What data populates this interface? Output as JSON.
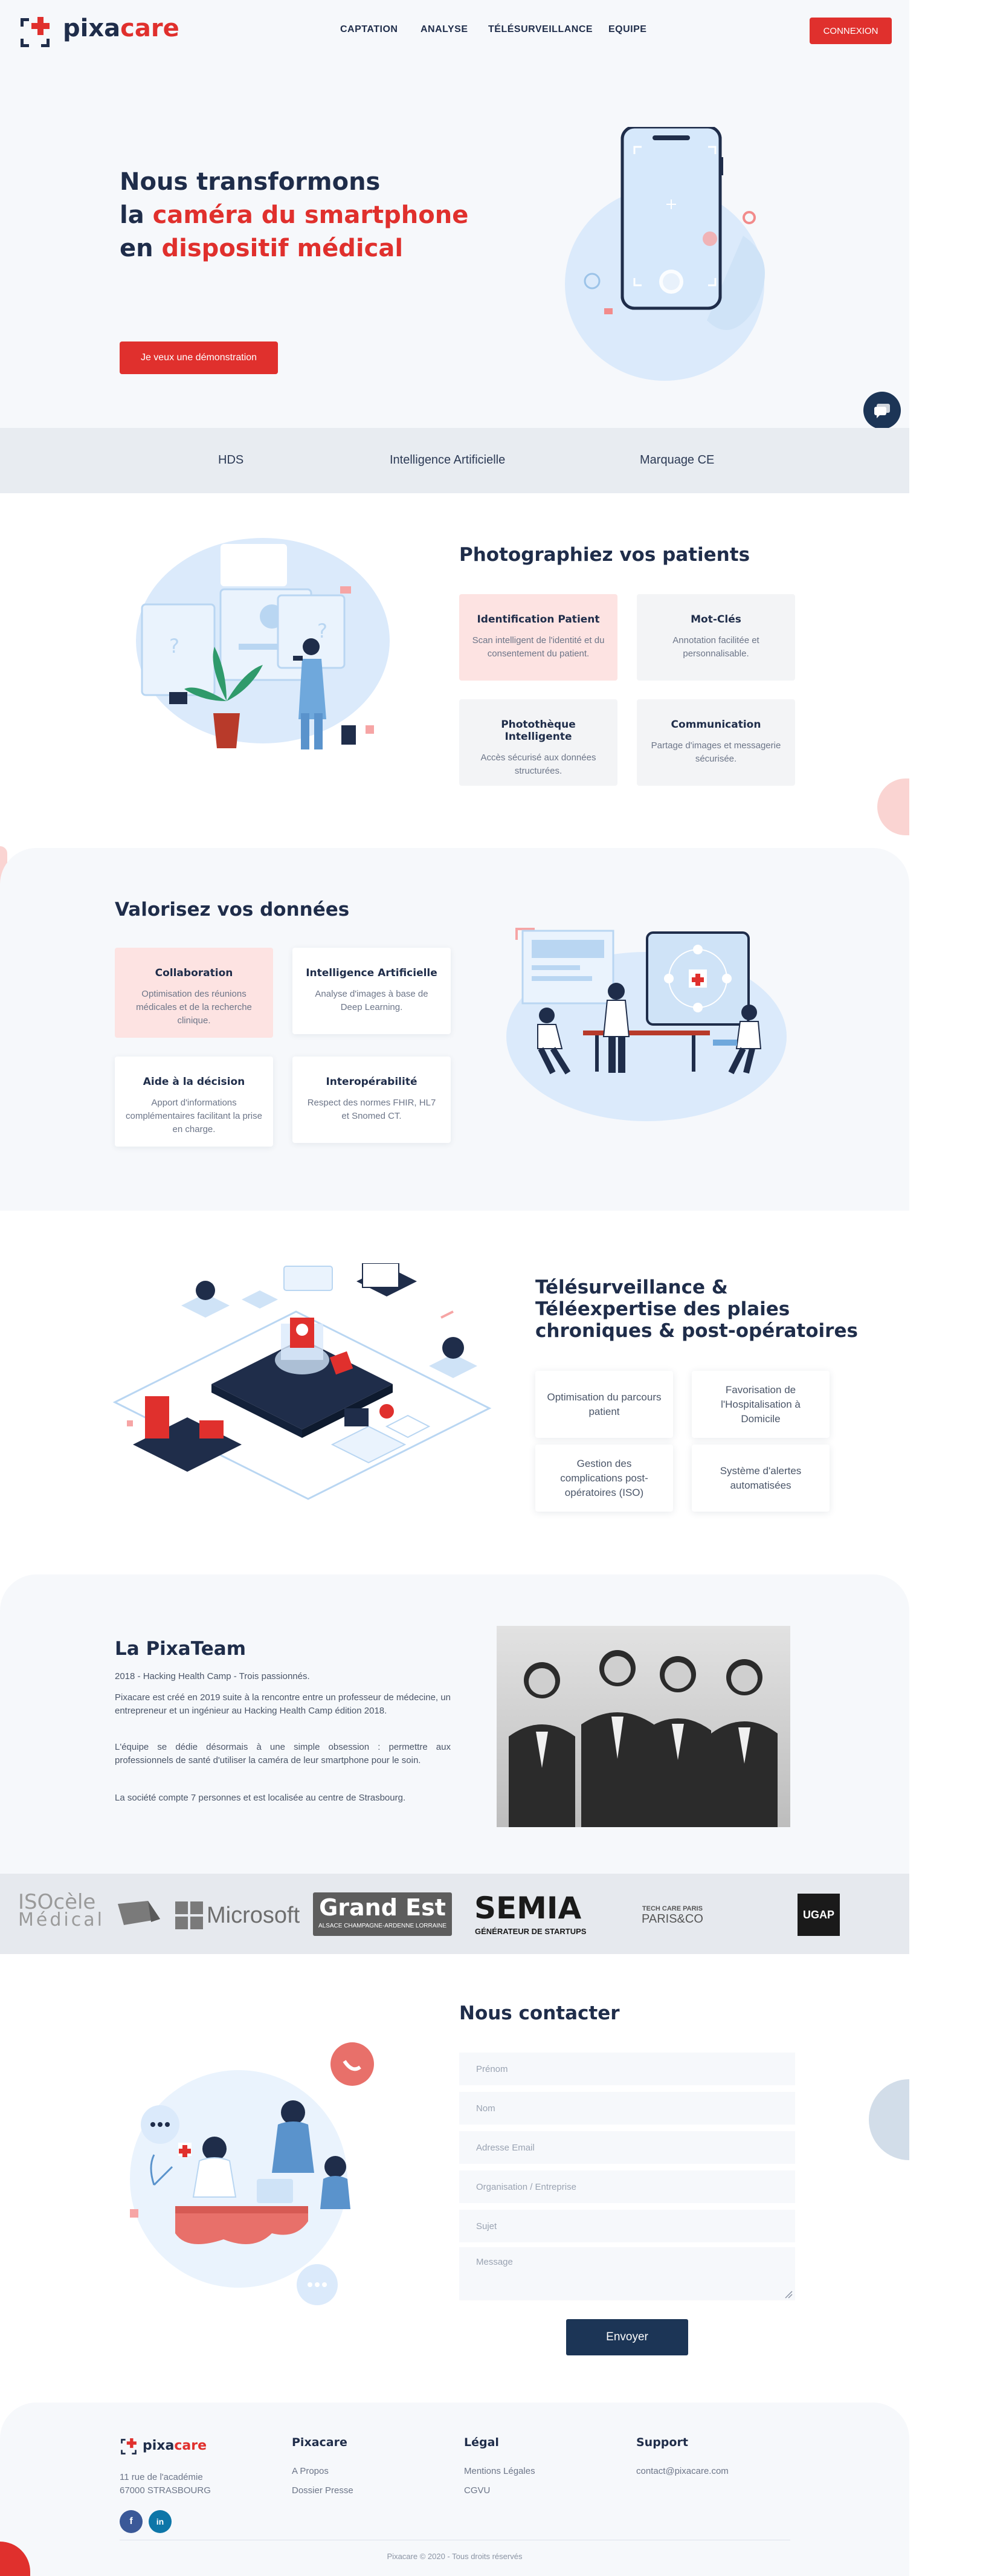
{
  "colors": {
    "primary_red": "#e0302d",
    "navy": "#1f2d4a",
    "light_bg": "#f6f8fb",
    "pink_card": "#fde3e2"
  },
  "header": {
    "logo_pixa": "pixa",
    "logo_care": "care",
    "nav": [
      "CAPTATION",
      "ANALYSE",
      "TÉLÉSURVEILLANCE",
      "EQUIPE"
    ],
    "login": "CONNEXION"
  },
  "hero": {
    "line1": "Nous transformons",
    "line2_prefix": "la ",
    "line2_highlight": "caméra du smartphone",
    "line3_prefix": "en ",
    "line3_highlight": "dispositif médical",
    "cta": "Je veux une démonstration"
  },
  "band": [
    "HDS",
    "Intelligence Artificielle",
    "Marquage CE"
  ],
  "photo": {
    "title": "Photographiez vos patients",
    "cards": [
      {
        "title": "Identification Patient",
        "text": "Scan intelligent de l'identité et du consentement du patient."
      },
      {
        "title": "Mot-Clés",
        "text": "Annotation facilitée et personnalisable."
      },
      {
        "title": "Photothèque Intelligente",
        "text": "Accès sécurisé aux données structurées."
      },
      {
        "title": "Communication",
        "text": "Partage d'images et messagerie sécurisée."
      }
    ]
  },
  "data_section": {
    "title": "Valorisez vos données",
    "cards": [
      {
        "title": "Collaboration",
        "text": "Optimisation des réunions médicales et de la recherche clinique."
      },
      {
        "title": "Intelligence Artificielle",
        "text": "Analyse d'images à base de Deep Learning."
      },
      {
        "title": "Aide à la décision",
        "text": "Apport d'informations complémentaires facilitant la prise en charge."
      },
      {
        "title": "Interopérabilité",
        "text": "Respect des normes FHIR, HL7 et Snomed CT."
      }
    ]
  },
  "tele": {
    "title_l1": "Télésurveillance &",
    "title_l2": "Téléexpertise des plaies",
    "title_l3": "chroniques & post-opératoires",
    "cards": [
      "Optimisation du parcours patient",
      "Favorisation de l'Hospitalisation à Domicile",
      "Gestion des complications post-opératoires (ISO)",
      "Système d'alertes automatisées"
    ]
  },
  "team": {
    "title": "La PixaTeam",
    "p1": "2018 - Hacking Health Camp - Trois passionnés.",
    "p2": "Pixacare est créé en 2019 suite à la rencontre entre un professeur de médecine, un entrepreneur et un ingénieur au Hacking Health Camp édition 2018.",
    "p3": "L'équipe se dédie désormais à une simple obsession : permettre aux professionnels de santé d'utiliser la caméra de leur smartphone pour le soin.",
    "p4": "La société compte 7 personnes et est localisée au centre de Strasbourg."
  },
  "partners": {
    "iso_l1": "ISOcèle",
    "iso_l2": "Médical",
    "microsoft": "Microsoft",
    "grandest": "Grand Est",
    "grandest_sub": "ALSACE CHAMPAGNE-ARDENNE LORRAINE",
    "semia": "SEMIA",
    "semia_sub": "GÉNÉRATEUR DE STARTUPS",
    "techcare_l1": "TECH CARE PARIS",
    "techcare_l2": "PARIS&CO",
    "ugap": "UGAP"
  },
  "contact": {
    "title": "Nous contacter",
    "fields": [
      "Prénom",
      "Nom",
      "Adresse Email",
      "Organisation / Entreprise",
      "Sujet"
    ],
    "message": "Message",
    "send": "Envoyer"
  },
  "footer": {
    "address_l1": "11 rue de l'académie",
    "address_l2": "67000 STRASBOURG",
    "col1_title": "Pixacare",
    "col1_links": [
      "A Propos",
      "Dossier Presse"
    ],
    "col2_title": "Légal",
    "col2_links": [
      "Mentions Légales",
      "CGVU"
    ],
    "col3_title": "Support",
    "col3_email": "contact@pixacare.com",
    "social_fb": "f",
    "social_in": "in",
    "copyright": "Pixacare © 2020 - Tous droits réservés"
  }
}
